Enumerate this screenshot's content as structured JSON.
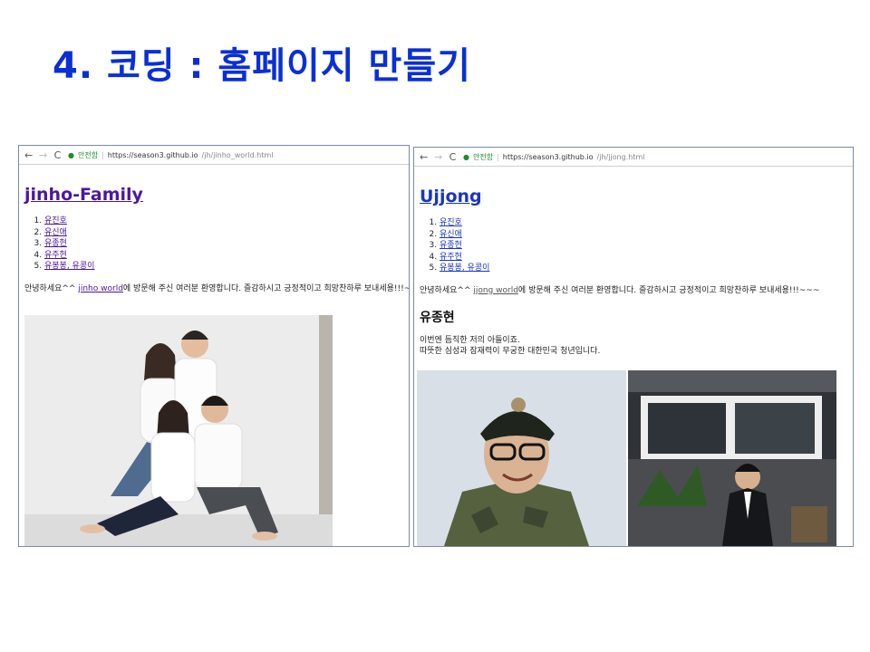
{
  "slide": {
    "title": "4. 코딩 : 홈페이지 만들기",
    "title_color": "#0a2fd8"
  },
  "left_browser": {
    "nav": {
      "back": "←",
      "forward": "→",
      "reload": "C"
    },
    "secure_label": "안전함",
    "url_host": "https://season3.github.io",
    "url_path": "/jh/jinho_world.html",
    "page_title": "jinho-Family",
    "list_items": [
      "유진호",
      "유신애",
      "유종현",
      "유주현",
      "유봉봉, 유콩이"
    ],
    "greeting_prefix": "안녕하세요^^ ",
    "greeting_link": "jinho world",
    "greeting_suffix": "에 방문해 주신 여러분 환영합니다. 즐감하시고 긍정적이고 희망찬하루 보내세용!!!~~~"
  },
  "right_browser": {
    "nav": {
      "back": "←",
      "forward": "→",
      "reload": "C"
    },
    "secure_label": "안전함",
    "url_host": "https://season3.github.io",
    "url_path": "/jh/jjong.html",
    "page_title": "Ujjong",
    "list_items": [
      "유진호",
      "유신애",
      "유종현",
      "유주현",
      "유봉봉, 유콩이"
    ],
    "greeting_prefix": "안녕하세요^^ ",
    "greeting_link": "jjong world",
    "greeting_suffix": "에 방문해 주신 여러분 환영합니다. 즐감하시고 긍정적이고 희망찬하루 보내세용!!!~~~",
    "section_heading": "유종현",
    "desc_line1": "이번엔 듬직한 저의 아들이죠.",
    "desc_line2": "따뜻한 심성과 잠재력이 무궁한 대한민국 청년입니다."
  }
}
